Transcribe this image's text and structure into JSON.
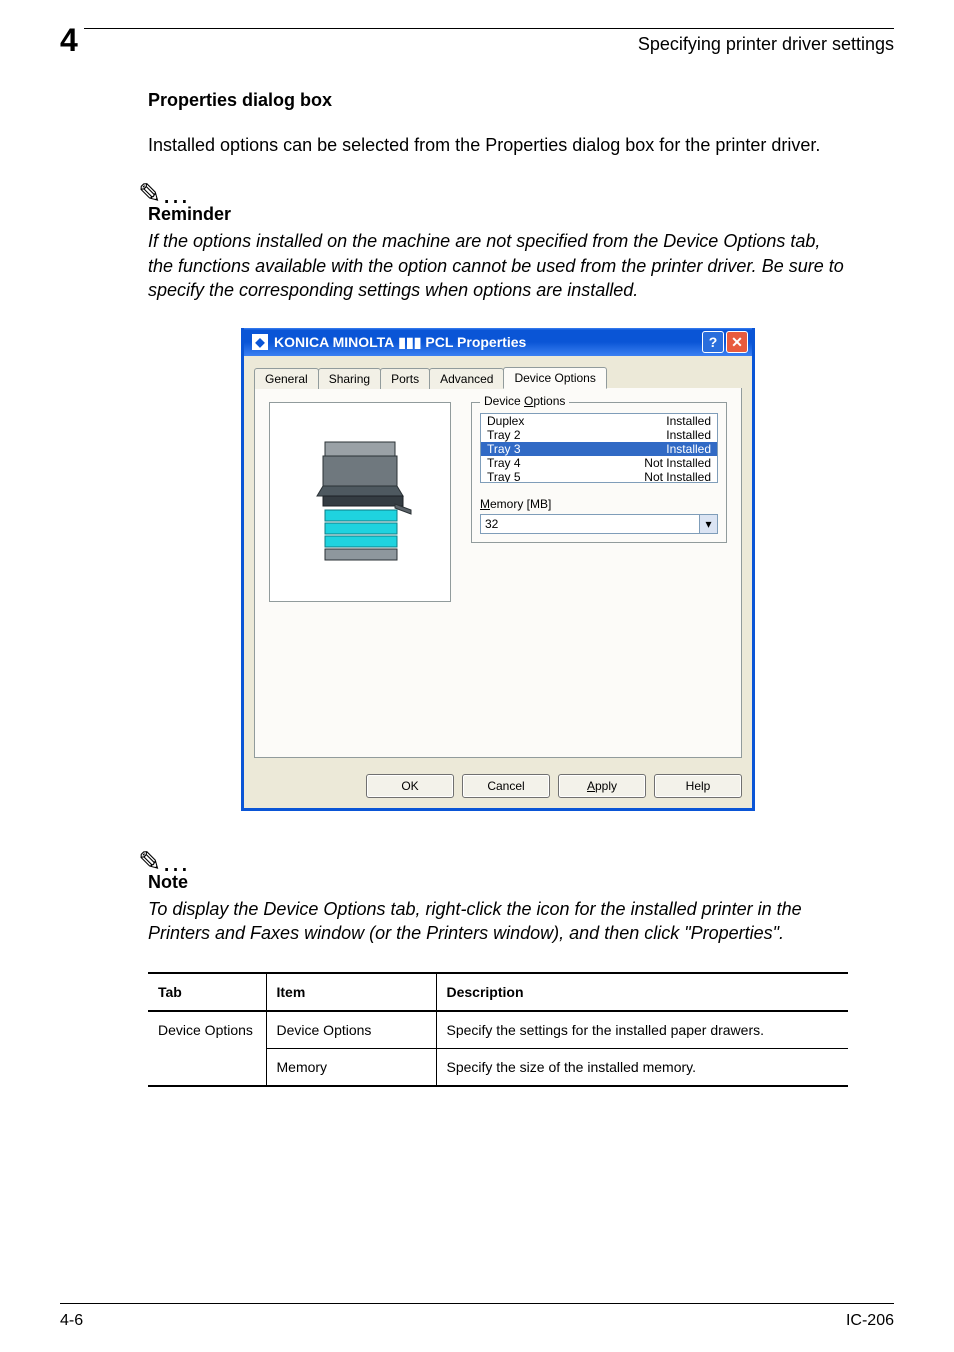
{
  "header": {
    "chapter_number": "4",
    "running_title": "Specifying printer driver settings"
  },
  "section": {
    "heading": "Properties dialog box",
    "intro": "Installed options can be selected from the Properties dialog box for the printer driver."
  },
  "reminder": {
    "icon_text": "✎…",
    "label": "Reminder",
    "body": "If the options installed on the machine are not specified from the Device Options tab, the functions available with the option cannot be used from the printer driver. Be sure to specify the corresponding settings when options are installed."
  },
  "dialog": {
    "title_prefix": "KONICA MINOLTA",
    "title_suffix": " PCL Properties",
    "title_masked": "▮▮▮",
    "help_glyph": "?",
    "close_glyph": "✕",
    "tabs": {
      "general": "General",
      "sharing": "Sharing",
      "ports": "Ports",
      "advanced": "Advanced",
      "device_options": "Device Options"
    },
    "group_legend": "Device Options",
    "options": [
      {
        "name": "Duplex",
        "status": "Installed"
      },
      {
        "name": "Tray 2",
        "status": "Installed"
      },
      {
        "name": "Tray 3",
        "status": "Installed"
      },
      {
        "name": "Tray 4",
        "status": "Not Installed"
      },
      {
        "name": "Tray 5",
        "status": "Not Installed"
      }
    ],
    "memory_label": "Memory [MB]",
    "memory_value": "32",
    "buttons": {
      "ok": "OK",
      "cancel": "Cancel",
      "apply": "Apply",
      "help": "Help"
    }
  },
  "note": {
    "icon_text": "✎…",
    "label": "Note",
    "body": "To display the Device Options tab, right-click the icon for the installed printer in the Printers and Faxes window (or the Printers window), and then click \"Properties\"."
  },
  "table": {
    "headers": {
      "tab": "Tab",
      "item": "Item",
      "description": "Description"
    },
    "rows": [
      {
        "tab": "Device Options",
        "item": "Device Options",
        "description": "Specify the settings for the installed paper drawers."
      },
      {
        "tab": "",
        "item": "Memory",
        "description": "Specify the size of the installed memory."
      }
    ]
  },
  "footer": {
    "page": "4-6",
    "model": "IC-206"
  }
}
